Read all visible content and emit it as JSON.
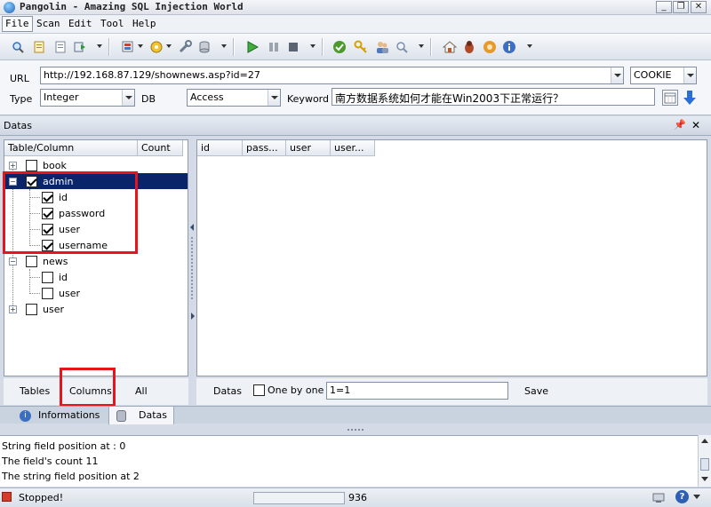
{
  "window": {
    "title": "Pangolin - Amazing SQL Injection World",
    "controls": [
      "minimize-icon",
      "restore-icon",
      "close-icon"
    ]
  },
  "menu": [
    "File",
    "Scan",
    "Edit",
    "Tool",
    "Help"
  ],
  "query": {
    "url_label": "URL",
    "url": "http://192.168.87.129/shownews.asp?id=27",
    "method": "COOKIE",
    "type_label": "Type",
    "type": "Integer",
    "db_label": "DB",
    "db": "Access",
    "keyword_label": "Keyword",
    "keyword": "南方数据系统如何才能在Win2003下正常运行？"
  },
  "datas_panel": {
    "title": "Datas",
    "tree_columns": [
      "Table/Column",
      "Count"
    ],
    "tree": [
      {
        "label": "book",
        "checked": false,
        "expanded": false
      },
      {
        "label": "admin",
        "checked": true,
        "expanded": true,
        "selected": true,
        "children": [
          {
            "label": "id",
            "checked": true
          },
          {
            "label": "password",
            "checked": true
          },
          {
            "label": "user",
            "checked": true
          },
          {
            "label": "username",
            "checked": true
          }
        ]
      },
      {
        "label": "news",
        "checked": false,
        "expanded": true,
        "children": [
          {
            "label": "id",
            "checked": false
          },
          {
            "label": "user",
            "checked": false
          }
        ]
      },
      {
        "label": "user",
        "checked": false,
        "expanded": false
      }
    ],
    "grid_columns": [
      "id",
      "pass...",
      "user",
      "user..."
    ],
    "tree_buttons": [
      "Tables",
      "Columns",
      "All"
    ],
    "datas_button": "Datas",
    "one_by_one_label": "One by one",
    "condition": "1=1",
    "save_button": "Save"
  },
  "tabs": [
    {
      "label": "Informations",
      "icon": "info-icon",
      "active": false
    },
    {
      "label": "Datas",
      "icon": "database-icon",
      "active": true
    }
  ],
  "log_lines": [
    "String field position at : 0",
    "The field's count 11",
    "The string field position at 2"
  ],
  "status": {
    "state": "Stopped!",
    "count": "936"
  },
  "colors": {
    "selection": "#0a246a",
    "highlight": "#e8141b"
  }
}
